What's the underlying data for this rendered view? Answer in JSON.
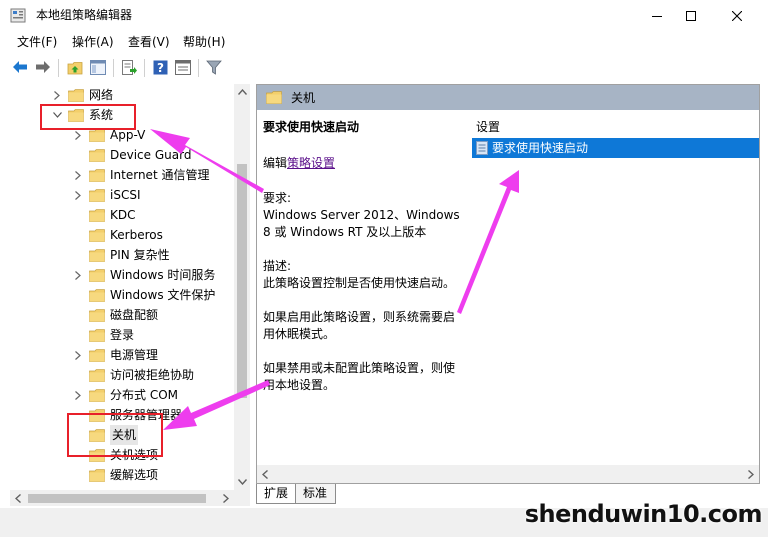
{
  "window": {
    "title": "本地组策略编辑器",
    "controls": {
      "minimize": "minimize-icon",
      "maximize": "maximize-icon",
      "close": "close-icon"
    }
  },
  "menu": [
    {
      "label": "文件(F)"
    },
    {
      "label": "操作(A)"
    },
    {
      "label": "查看(V)"
    },
    {
      "label": "帮助(H)"
    }
  ],
  "toolbar": {
    "icons": [
      "back-arrow-icon",
      "forward-arrow-icon",
      "up-folder-icon",
      "show-hide-tree-icon",
      "export-list-icon",
      "help-icon",
      "properties-icon",
      "filter-icon"
    ]
  },
  "tree": {
    "items": [
      {
        "label": "网络",
        "expandable": true,
        "expanded": false
      },
      {
        "label": "系统",
        "expandable": true,
        "expanded": true
      },
      {
        "label": "App-V",
        "expandable": true,
        "expanded": false
      },
      {
        "label": "Device Guard",
        "expandable": false
      },
      {
        "label": "Internet 通信管理",
        "expandable": true,
        "expanded": false
      },
      {
        "label": "iSCSI",
        "expandable": true,
        "expanded": false
      },
      {
        "label": "KDC",
        "expandable": false
      },
      {
        "label": "Kerberos",
        "expandable": false
      },
      {
        "label": "PIN 复杂性",
        "expandable": false
      },
      {
        "label": "Windows 时间服务",
        "expandable": true,
        "expanded": false
      },
      {
        "label": "Windows 文件保护",
        "expandable": false
      },
      {
        "label": "磁盘配额",
        "expandable": false
      },
      {
        "label": "登录",
        "expandable": false
      },
      {
        "label": "电源管理",
        "expandable": true,
        "expanded": false
      },
      {
        "label": "访问被拒绝协助",
        "expandable": false
      },
      {
        "label": "分布式 COM",
        "expandable": true,
        "expanded": false
      },
      {
        "label": "服务器管理器",
        "expandable": false
      },
      {
        "label": "关机",
        "expandable": false,
        "selected": true
      },
      {
        "label": "关机选项",
        "expandable": false
      },
      {
        "label": "缓解选项",
        "expandable": false
      }
    ]
  },
  "right_pane": {
    "header": "关机",
    "description": {
      "title": "要求使用快速启动",
      "edit_prefix": "编辑",
      "edit_link": "策略设置",
      "requirements_heading": "要求:",
      "requirements": "Windows Server 2012、Windows 8 或 Windows RT 及以上版本",
      "description_heading": "描述:",
      "description": "此策略设置控制是否使用快速启动。",
      "para_enabled": "如果启用此策略设置，则系统需要启用休眠模式。",
      "para_disabled": "如果禁用或未配置此策略设置，则使用本地设置。"
    },
    "list_header": "设置",
    "list_items": [
      {
        "label": "要求使用快速启动",
        "selected": true
      }
    ]
  },
  "tabs": [
    {
      "label": "扩展",
      "active": true
    },
    {
      "label": "标准",
      "active": false
    }
  ],
  "watermark": "shenduwin10.com",
  "colors": {
    "selection": "#0e78d7",
    "header_band": "#a7b4c5",
    "highlight_box": "#e8202a",
    "annotation_arrow": "#ee3dee",
    "folder": "#f3cf6b",
    "link": "#5a0f8a"
  }
}
